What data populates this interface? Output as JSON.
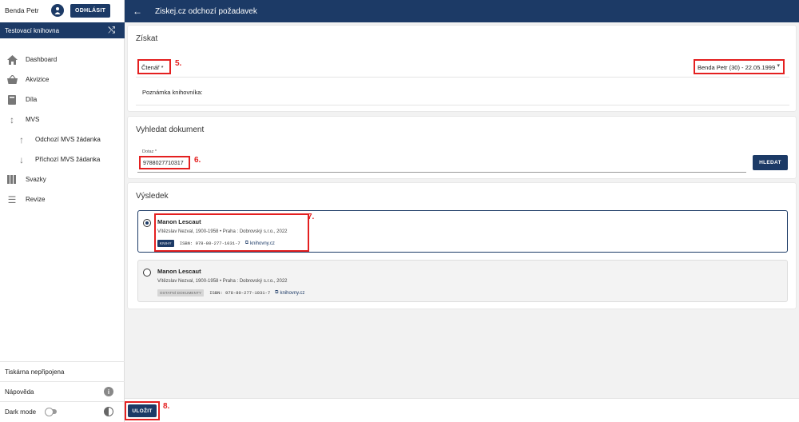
{
  "user": {
    "name": "Benda Petr",
    "logout_label": "ODHLÁSIT"
  },
  "library": {
    "name": "Testovací knihovna"
  },
  "header": {
    "title": "Ziskej.cz odchozí požadavek"
  },
  "nav": {
    "dashboard": "Dashboard",
    "akvizice": "Akvizice",
    "dila": "Díla",
    "mvs": "MVS",
    "odchozi": "Odchozí MVS žádanka",
    "prichozi": "Příchozí MVS žádanka",
    "svazky": "Svazky",
    "revize": "Revize"
  },
  "bottom": {
    "printer": "Tiskárna nepřipojena",
    "help": "Nápověda",
    "dark_mode": "Dark mode"
  },
  "ziskat": {
    "title": "Získat",
    "reader_label": "Čtenář *",
    "reader_value": "Benda Petr (30) - 22.05.1999",
    "note_label": "Poznámka knihovníka:"
  },
  "search": {
    "title": "Vyhledat dokument",
    "query_label": "Dotaz *",
    "query_value": "9788027710317",
    "button": "HLEDAT"
  },
  "results": {
    "title": "Výsledek",
    "items": [
      {
        "title": "Manon Lescaut",
        "author": "Vítězslav Nezval, 1900-1958 • Praha : Dobrovský s.r.o., 2022",
        "badge": "KNIHY",
        "isbn": "ISBN: 978-80-277-1031-7",
        "link": "knihovny.cz",
        "selected": true
      },
      {
        "title": "Manon Lescaut",
        "author": "Vítězslav Nezval, 1900-1958 • Praha : Dobrovský s.r.o., 2022",
        "badge": "OSTATNÍ DOKUMENTY",
        "isbn": "ISBN: 978-80-277-1031-7",
        "link": "knihovny.cz",
        "selected": false
      }
    ]
  },
  "footer": {
    "save": "ULOŽIT"
  },
  "annotations": {
    "a5": "5.",
    "a6": "6.",
    "a7": "7.",
    "a8": "8."
  },
  "colors": {
    "primary": "#1c3a66",
    "annotation": "#e42020"
  }
}
